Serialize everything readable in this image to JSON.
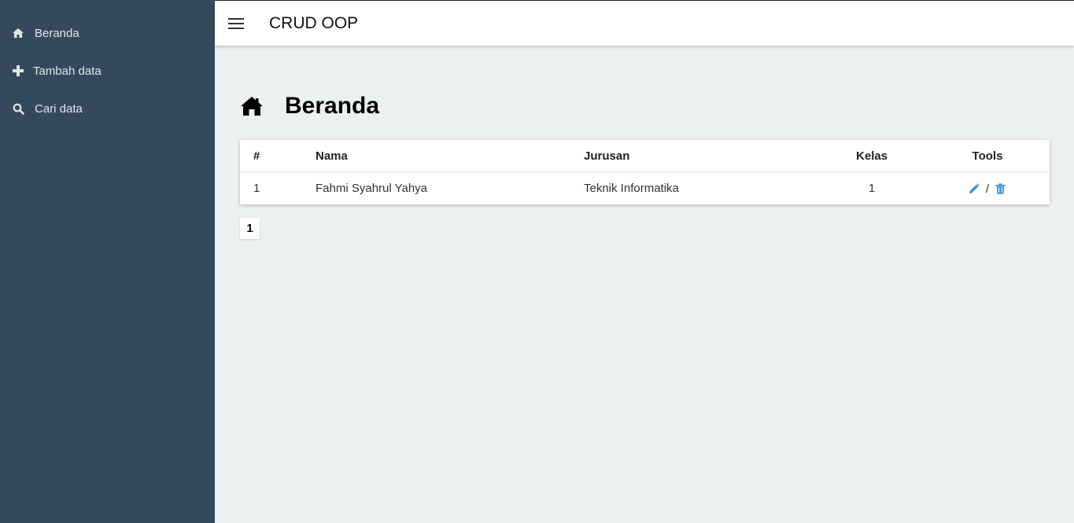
{
  "app": {
    "title": "CRUD OOP"
  },
  "sidebar": {
    "items": [
      {
        "label": "Beranda",
        "icon": "home-icon"
      },
      {
        "label": "Tambah data",
        "icon": "plus-icon"
      },
      {
        "label": "Cari data",
        "icon": "search-icon"
      }
    ]
  },
  "page": {
    "title": "Beranda",
    "icon": "home-icon"
  },
  "table": {
    "headers": {
      "no": "#",
      "nama": "Nama",
      "jurusan": "Jurusan",
      "kelas": "Kelas",
      "tools": "Tools"
    },
    "rows": [
      {
        "no": "1",
        "nama": "Fahmi Syahrul Yahya",
        "jurusan": "Teknik Informatika",
        "kelas": "1",
        "separator": "/"
      }
    ]
  },
  "pagination": {
    "pages": [
      "1"
    ],
    "current": "1"
  },
  "colors": {
    "sidebar": "#34495e",
    "background": "#ecf0f1",
    "accent": "#3a8fd8"
  }
}
